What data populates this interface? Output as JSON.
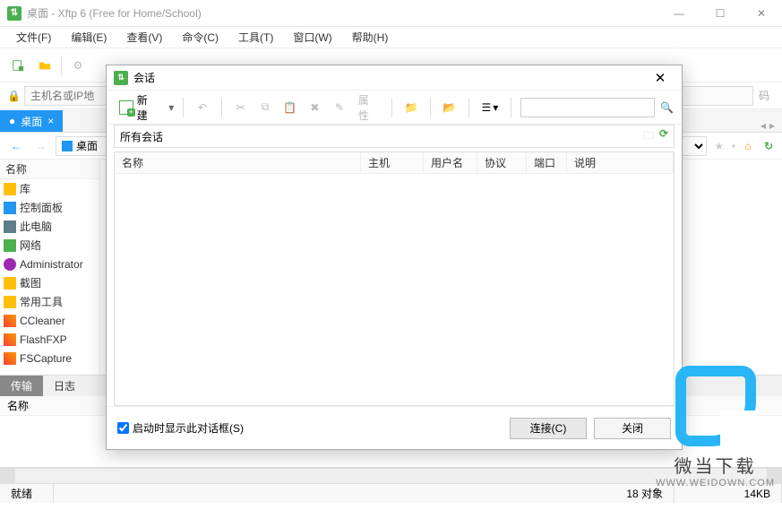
{
  "window": {
    "title": "桌面 - Xftp 6 (Free for Home/School)"
  },
  "menu": {
    "file": "文件(F)",
    "edit": "编辑(E)",
    "view": "查看(V)",
    "command": "命令(C)",
    "tool": "工具(T)",
    "window": "窗口(W)",
    "help": "帮助(H)"
  },
  "addressbar": {
    "placeholder": "主机名或IP地",
    "right_hint": "码"
  },
  "tab": {
    "label": "桌面"
  },
  "nav": {
    "path_label": "桌面"
  },
  "tree": {
    "header": "名称",
    "items": [
      "库",
      "控制面板",
      "此电脑",
      "网络",
      "Administrator",
      "截图",
      "常用工具",
      "CCleaner",
      "FlashFXP",
      "FSCapture"
    ]
  },
  "bottom_tabs": {
    "transfer": "传输",
    "log": "日志"
  },
  "log": {
    "header": "名称"
  },
  "status": {
    "ready": "就绪",
    "objects": "18 对象",
    "size": "14KB"
  },
  "dialog": {
    "title": "会话",
    "new_btn": "新建",
    "props": "属性",
    "breadcrumb": "所有会话",
    "columns": {
      "name": "名称",
      "host": "主机",
      "user": "用户名",
      "proto": "协议",
      "port": "端口",
      "desc": "说明"
    },
    "show_on_start": "启动时显示此对话框(S)",
    "connect": "连接(C)",
    "close": "关闭"
  },
  "watermark": {
    "name": "微当下载",
    "url": "WWW.WEIDOWN.COM"
  }
}
